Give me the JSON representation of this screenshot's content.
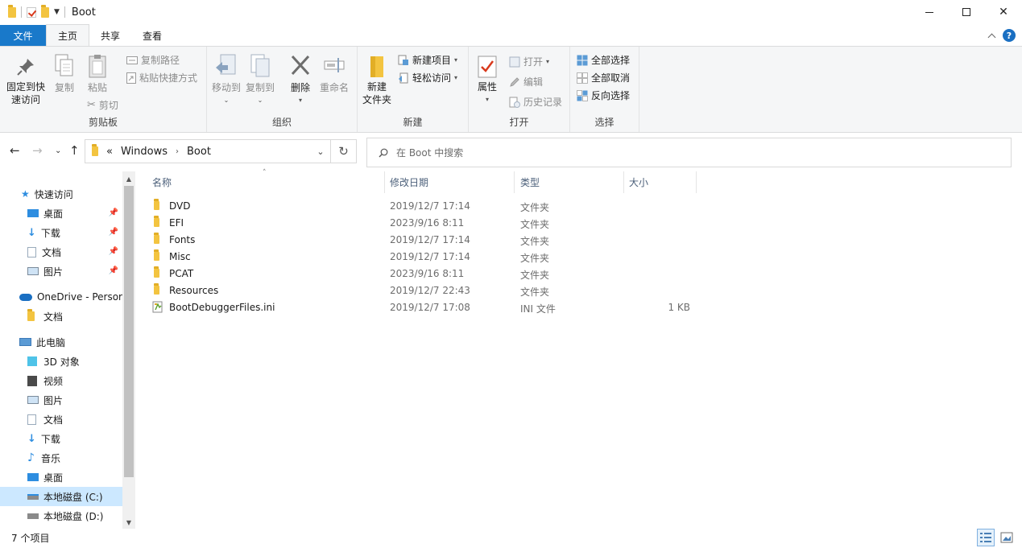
{
  "window": {
    "title": "Boot",
    "minimize_label": "",
    "close_label": "✕"
  },
  "tabs": [
    {
      "label": "文件"
    },
    {
      "label": "主页"
    },
    {
      "label": "共享"
    },
    {
      "label": "查看"
    }
  ],
  "help_label": "?",
  "ribbon": {
    "clipboard": {
      "label": "剪贴板",
      "pin_line1": "固定到快",
      "pin_line2": "速访问",
      "copy": "复制",
      "paste": "粘贴",
      "copy_path": "复制路径",
      "paste_shortcut": "粘贴快捷方式",
      "cut": "剪切"
    },
    "organize": {
      "label": "组织",
      "move_to": "移动到",
      "copy_to": "复制到",
      "delete": "删除",
      "rename": "重命名"
    },
    "new": {
      "label": "新建",
      "new_folder_line1": "新建",
      "new_folder_line2": "文件夹",
      "new_item": "新建项目",
      "easy_access": "轻松访问"
    },
    "open": {
      "label": "打开",
      "properties": "属性",
      "open": "打开",
      "edit": "编辑",
      "history": "历史记录"
    },
    "select": {
      "label": "选择",
      "select_all": "全部选择",
      "select_none": "全部取消",
      "invert": "反向选择"
    }
  },
  "address": {
    "overflow": "«",
    "crumbs": [
      "Windows",
      "Boot"
    ]
  },
  "search": {
    "placeholder": "在 Boot 中搜索"
  },
  "nav": {
    "quick_access": "快速访问",
    "quick_items": [
      "桌面",
      "下载",
      "文档",
      "图片"
    ],
    "onedrive": "OneDrive - Persor",
    "onedrive_items": [
      "文档"
    ],
    "this_pc": "此电脑",
    "pc_items": [
      "3D 对象",
      "视频",
      "图片",
      "文档",
      "下载",
      "音乐",
      "桌面",
      "本地磁盘 (C:)",
      "本地磁盘 (D:)"
    ]
  },
  "columns": {
    "name": "名称",
    "date": "修改日期",
    "type": "类型",
    "size": "大小"
  },
  "files": [
    {
      "name": "DVD",
      "date": "2019/12/7 17:14",
      "type": "文件夹",
      "size": "",
      "kind": "folder"
    },
    {
      "name": "EFI",
      "date": "2023/9/16 8:11",
      "type": "文件夹",
      "size": "",
      "kind": "folder"
    },
    {
      "name": "Fonts",
      "date": "2019/12/7 17:14",
      "type": "文件夹",
      "size": "",
      "kind": "folder"
    },
    {
      "name": "Misc",
      "date": "2019/12/7 17:14",
      "type": "文件夹",
      "size": "",
      "kind": "folder"
    },
    {
      "name": "PCAT",
      "date": "2023/9/16 8:11",
      "type": "文件夹",
      "size": "",
      "kind": "folder"
    },
    {
      "name": "Resources",
      "date": "2019/12/7 22:43",
      "type": "文件夹",
      "size": "",
      "kind": "folder"
    },
    {
      "name": "BootDebuggerFiles.ini",
      "date": "2019/12/7 17:08",
      "type": "INI 文件",
      "size": "1 KB",
      "kind": "ini"
    }
  ],
  "status": {
    "item_count": "7 个项目"
  }
}
